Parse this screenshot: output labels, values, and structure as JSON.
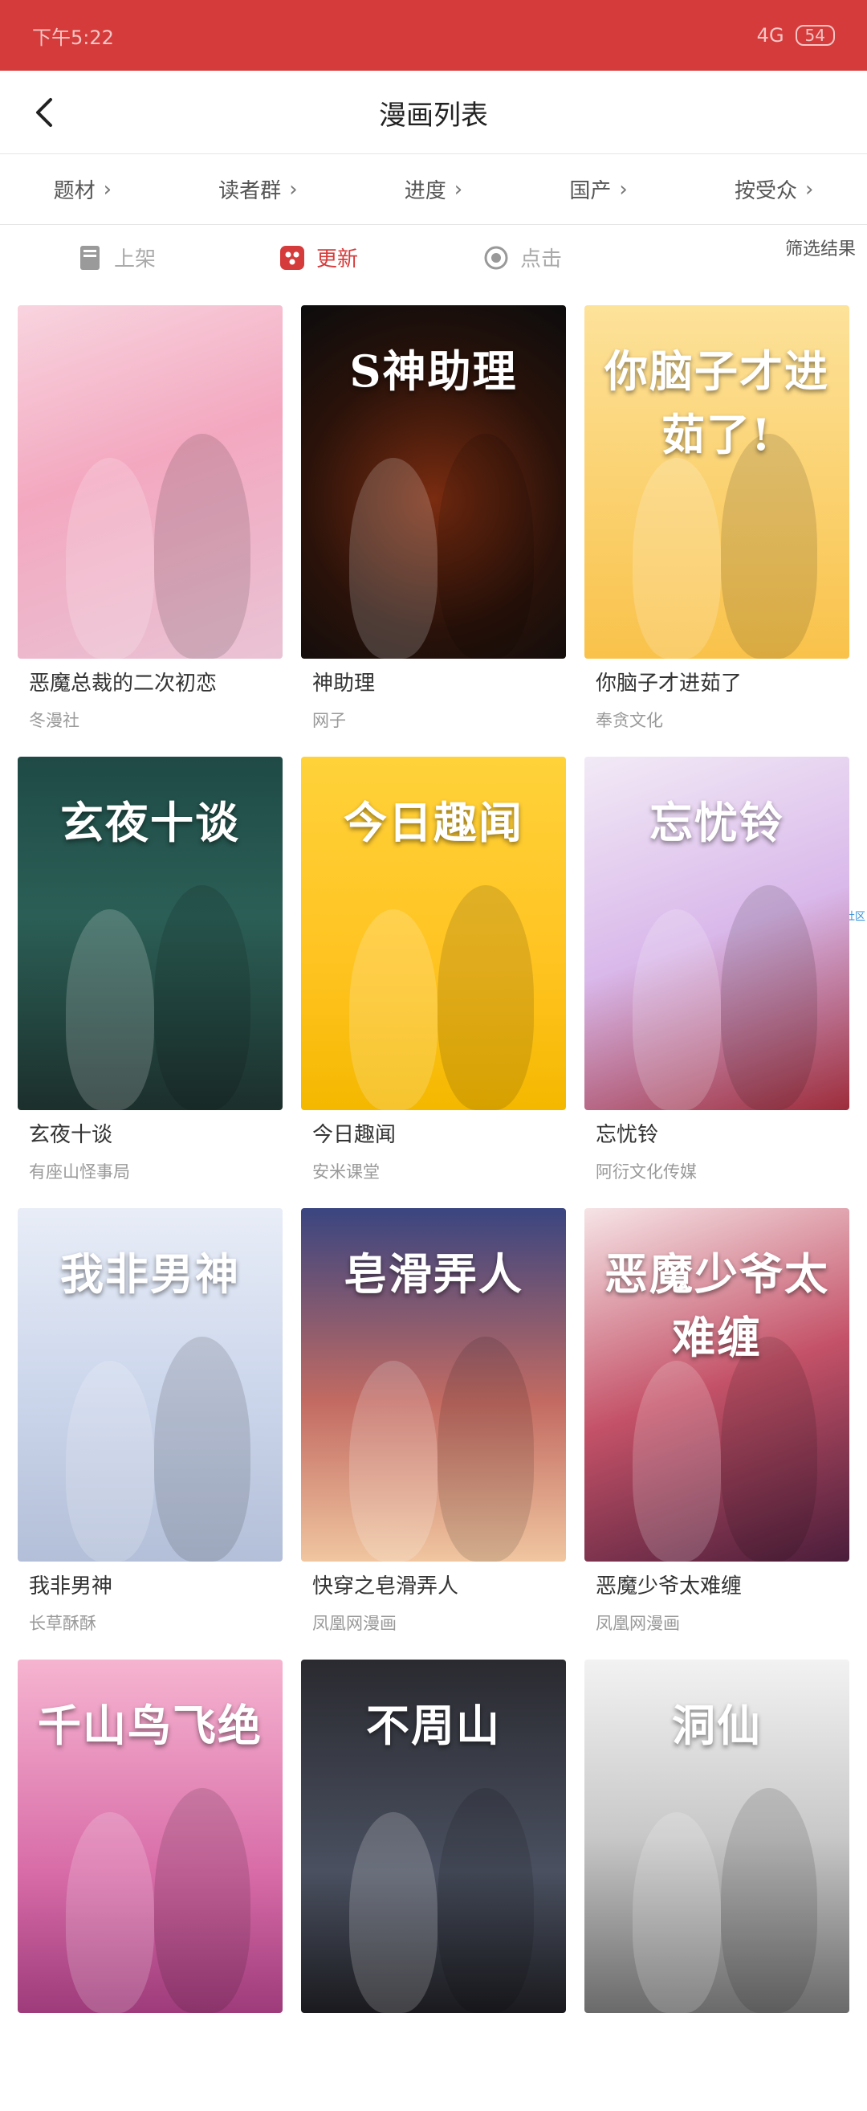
{
  "status": {
    "time": "下午5:22",
    "signal": "4G",
    "battery": "54"
  },
  "header": {
    "title": "漫画列表"
  },
  "filters": [
    {
      "label": "题材"
    },
    {
      "label": "读者群"
    },
    {
      "label": "进度"
    },
    {
      "label": "国产"
    },
    {
      "label": "按受众"
    }
  ],
  "sort": {
    "shelf": "上架",
    "update": "更新",
    "click": "点击",
    "result": "筛选结果"
  },
  "side_tag": "漫客社区",
  "comics": [
    {
      "title": "恶魔总裁的二次初恋",
      "author": "冬漫社",
      "cover_text": "",
      "theme": "c1"
    },
    {
      "title": "神助理",
      "author": "网子",
      "cover_text": "S神助理",
      "theme": "c2"
    },
    {
      "title": "你脑子才进茹了",
      "author": "奉贪文化",
      "cover_text": "你脑子才进茹了!",
      "theme": "c3"
    },
    {
      "title": "玄夜十谈",
      "author": "有座山怪事局",
      "cover_text": "玄夜十谈",
      "theme": "c4"
    },
    {
      "title": "今日趣闻",
      "author": "安米课堂",
      "cover_text": "今日趣闻",
      "theme": "c5"
    },
    {
      "title": "忘忧铃",
      "author": "阿衍文化传媒",
      "cover_text": "忘忧铃",
      "theme": "c6"
    },
    {
      "title": "我非男神",
      "author": "长草酥酥",
      "cover_text": "我非男神",
      "theme": "c7"
    },
    {
      "title": "快穿之皂滑弄人",
      "author": "凤凰网漫画",
      "cover_text": "皂滑弄人",
      "theme": "c8"
    },
    {
      "title": "恶魔少爷太难缠",
      "author": "凤凰网漫画",
      "cover_text": "恶魔少爷太难缠",
      "theme": "c9"
    },
    {
      "title": "",
      "author": "",
      "cover_text": "千山鸟飞绝",
      "theme": "c10"
    },
    {
      "title": "",
      "author": "",
      "cover_text": "不周山",
      "theme": "c11"
    },
    {
      "title": "",
      "author": "",
      "cover_text": "洞仙",
      "theme": "c12"
    }
  ]
}
